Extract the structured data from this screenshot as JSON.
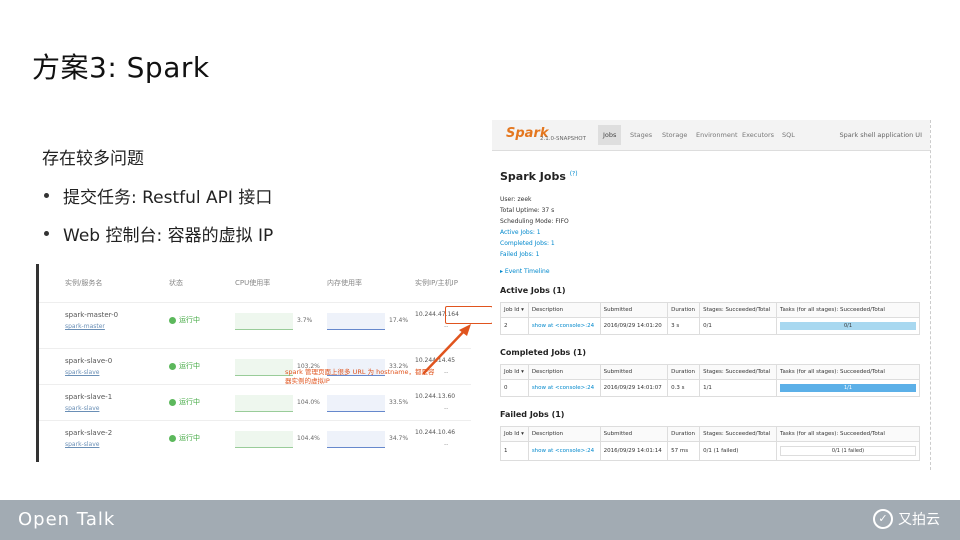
{
  "slide": {
    "title": "方案3: Spark",
    "heading": "存在较多问题",
    "bullets": [
      "提交任务: Restful API 接口",
      "Web 控制台: 容器的虚拟 IP"
    ]
  },
  "container_list": {
    "headers": [
      "实例/服务名",
      "状态",
      "CPU使用率",
      "内存使用率",
      "实例IP/主机IP"
    ],
    "rows": [
      {
        "name": "spark-master-0",
        "sub": "spark-master",
        "status": "运行中",
        "cpu": "3.7%",
        "mem": "17.4%",
        "ip": "10.244.47.164",
        "ip_sub": "--"
      },
      {
        "name": "spark-slave-0",
        "sub": "spark-slave",
        "status": "运行中",
        "cpu": "103.2%",
        "mem": "33.2%",
        "ip": "10.244.14.45",
        "ip_sub": "--"
      },
      {
        "name": "spark-slave-1",
        "sub": "spark-slave",
        "status": "运行中",
        "cpu": "104.0%",
        "mem": "33.5%",
        "ip": "10.244.13.60",
        "ip_sub": "--"
      },
      {
        "name": "spark-slave-2",
        "sub": "spark-slave",
        "status": "运行中",
        "cpu": "104.4%",
        "mem": "34.7%",
        "ip": "10.244.10.46",
        "ip_sub": "--"
      }
    ],
    "annotation": "spark 管理页面上很多 URL 为 hostname，都是容器实例的虚拟IP"
  },
  "spark_ui": {
    "logo": "Spark",
    "version": "2.1.0-SNAPSHOT",
    "tabs": [
      "Jobs",
      "Stages",
      "Storage",
      "Environment",
      "Executors",
      "SQL"
    ],
    "app_name": "Spark shell application UI",
    "page_title": "Spark Jobs",
    "help": "(?)",
    "user": "User: zeek",
    "uptime": "Total Uptime: 37 s",
    "mode": "Scheduling Mode: FIFO",
    "active_link": "Active Jobs: 1",
    "completed_link": "Completed Jobs: 1",
    "failed_link": "Failed Jobs: 1",
    "timeline": "▸ Event Timeline",
    "table_headers": [
      "Job Id ▾",
      "Description",
      "Submitted",
      "Duration",
      "Stages: Succeeded/Total",
      "Tasks (for all stages): Succeeded/Total"
    ],
    "active": {
      "title": "Active Jobs (1)",
      "id": "2",
      "desc": "show at <console>:24",
      "submitted": "2016/09/29 14:01:20",
      "duration": "3 s",
      "stages": "0/1",
      "tasks": "0/1"
    },
    "completed": {
      "title": "Completed Jobs (1)",
      "id": "0",
      "desc": "show at <console>:24",
      "submitted": "2016/09/29 14:01:07",
      "duration": "0.3 s",
      "stages": "1/1",
      "tasks": "1/1"
    },
    "failed": {
      "title": "Failed Jobs (1)",
      "id": "1",
      "desc": "show at <console>:24",
      "submitted": "2016/09/29 14:01:14",
      "duration": "57 ms",
      "stages": "0/1 (1 failed)",
      "tasks": "0/1 (1 failed)"
    }
  },
  "footer": {
    "brand": "Open Talk",
    "logo_text": "又拍云",
    "logo_icon": "upyun-logo-icon"
  }
}
